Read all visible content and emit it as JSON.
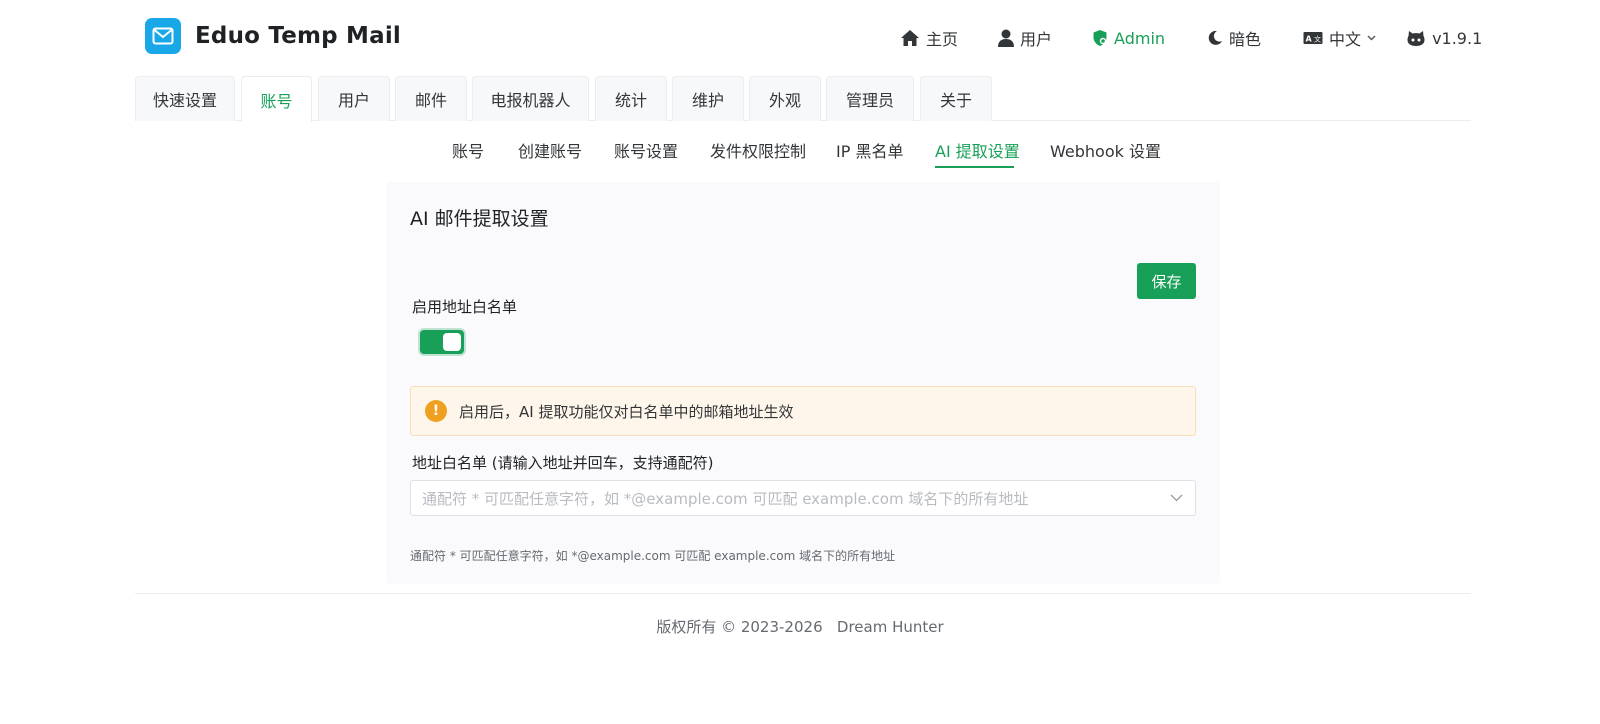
{
  "brand": {
    "title": "Eduo Temp Mail",
    "logo_icon": "mail-icon",
    "logo_color": "#18a8e8"
  },
  "nav": {
    "home": "主页",
    "user": "用户",
    "admin": "Admin",
    "theme": "暗色",
    "language": "中文",
    "version": "v1.9.1"
  },
  "top_tabs": [
    "快速设置",
    "账号",
    "用户",
    "邮件",
    "电报机器人",
    "统计",
    "维护",
    "外观",
    "管理员",
    "关于"
  ],
  "active_top_tab": "账号",
  "sub_tabs": [
    "账号",
    "创建账号",
    "账号设置",
    "发件权限控制",
    "IP 黑名单",
    "AI 提取设置",
    "Webhook 设置"
  ],
  "active_sub_tab": "AI 提取设置",
  "card": {
    "title": "AI 邮件提取设置",
    "save_label": "保存",
    "whitelist_toggle_label": "启用地址白名单",
    "whitelist_enabled": true,
    "alert_text": "启用后，AI 提取功能仅对白名单中的邮箱地址生效",
    "whitelist_label": "地址白名单 (请输入地址并回车，支持通配符)",
    "whitelist_placeholder": "通配符 * 可匹配任意字符，如 *@example.com 可匹配 example.com 域名下的所有地址",
    "help_text": "通配符 * 可匹配任意字符，如 *@example.com 可匹配 example.com 域名下的所有地址"
  },
  "footer": {
    "text": "版权所有 © 2023-2026   Dream Hunter"
  },
  "colors": {
    "accent": "#18a058",
    "warning": "#f0a020",
    "warning_bg": "#fef6ea"
  }
}
